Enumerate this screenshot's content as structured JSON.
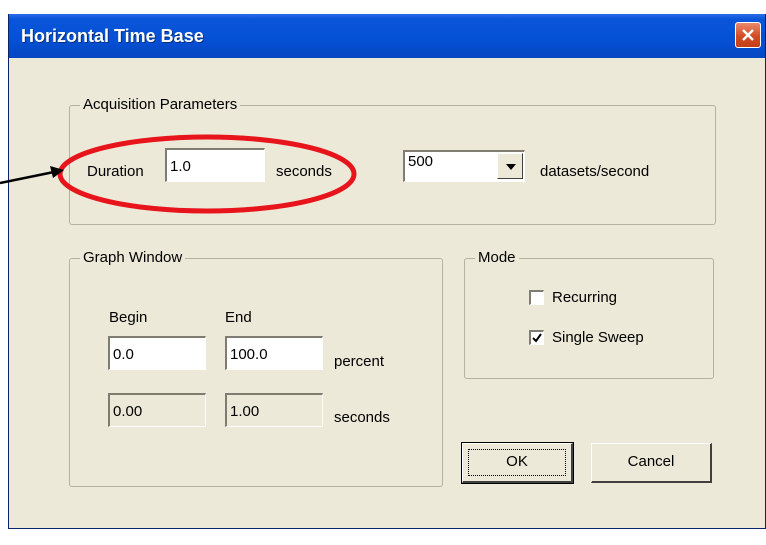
{
  "window": {
    "title": "Horizontal Time Base",
    "close_label": "Close"
  },
  "acquisition": {
    "group_label": "Acquisition Parameters",
    "duration_label": "Duration",
    "duration_value": "1.0",
    "duration_unit": "seconds",
    "rate_value": "500",
    "rate_unit": "datasets/second"
  },
  "graph_window": {
    "group_label": "Graph Window",
    "begin_label": "Begin",
    "end_label": "End",
    "begin_percent": "0.0",
    "end_percent": "100.0",
    "percent_unit": "percent",
    "begin_seconds": "0.00",
    "end_seconds": "1.00",
    "seconds_unit": "seconds"
  },
  "mode": {
    "group_label": "Mode",
    "options": [
      {
        "label": "Recurring",
        "checked": false
      },
      {
        "label": "Single Sweep",
        "checked": true
      }
    ]
  },
  "buttons": {
    "ok": "OK",
    "cancel": "Cancel"
  },
  "annotation": {
    "highlight_color": "#e8141b",
    "arrow_color": "#000000"
  }
}
